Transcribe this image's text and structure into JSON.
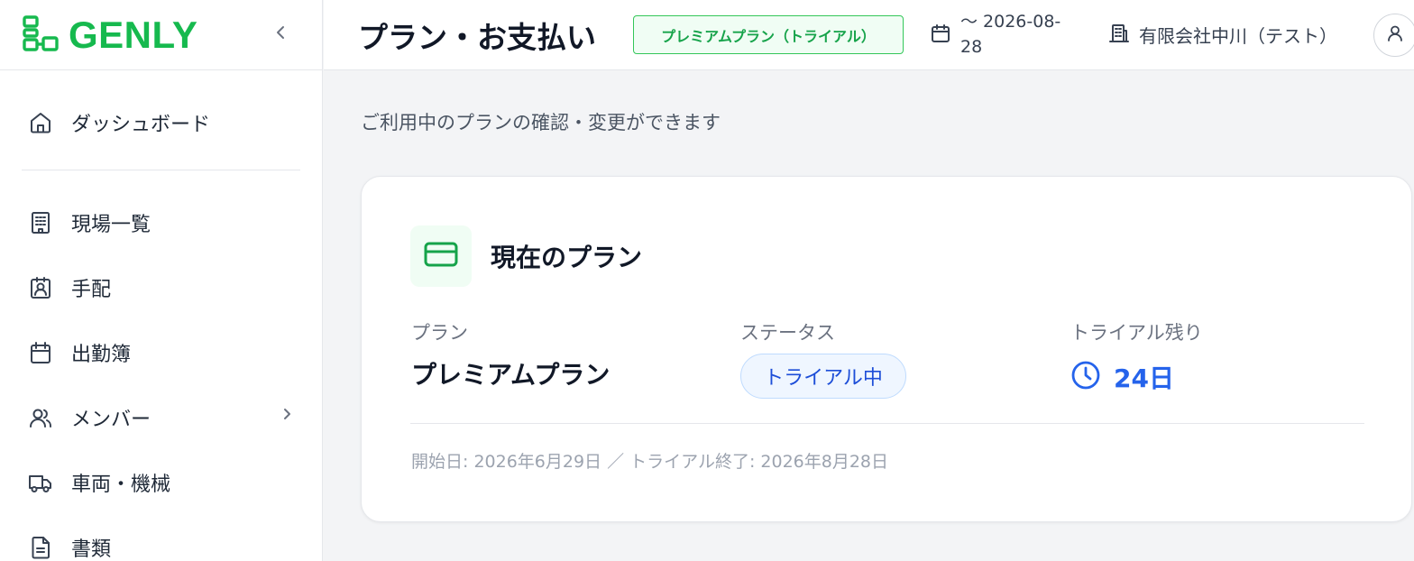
{
  "brand": {
    "name": "GENLY"
  },
  "sidebar": {
    "items": [
      {
        "label": "ダッシュボード",
        "icon": "home-icon"
      },
      {
        "label": "現場一覧",
        "icon": "building-icon"
      },
      {
        "label": "手配",
        "icon": "id-badge-icon"
      },
      {
        "label": "出勤簿",
        "icon": "calendar-icon"
      },
      {
        "label": "メンバー",
        "icon": "users-icon"
      },
      {
        "label": "車両・機械",
        "icon": "truck-icon"
      },
      {
        "label": "書類",
        "icon": "document-icon"
      }
    ]
  },
  "header": {
    "title": "プラン・お支払い",
    "plan_badge": "プレミアムプラン（トライアル）",
    "date_range": "〜 2026-08-28",
    "company": "有限会社中川（テスト）"
  },
  "main": {
    "subtitle": "ご利用中のプランの確認・変更ができます",
    "card": {
      "title": "現在のプラン",
      "plan_label": "プラン",
      "plan_value": "プレミアムプラン",
      "status_label": "ステータス",
      "status_value": "トライアル中",
      "trial_label": "トライアル残り",
      "trial_value": "24日",
      "footer": "開始日: 2026年6月29日 ／ トライアル終了: 2026年8月28日"
    }
  },
  "colors": {
    "brand_green": "#16b94e",
    "badge_green": "#16a34a",
    "status_blue": "#2563eb",
    "sidebar_icon": "#374151"
  }
}
